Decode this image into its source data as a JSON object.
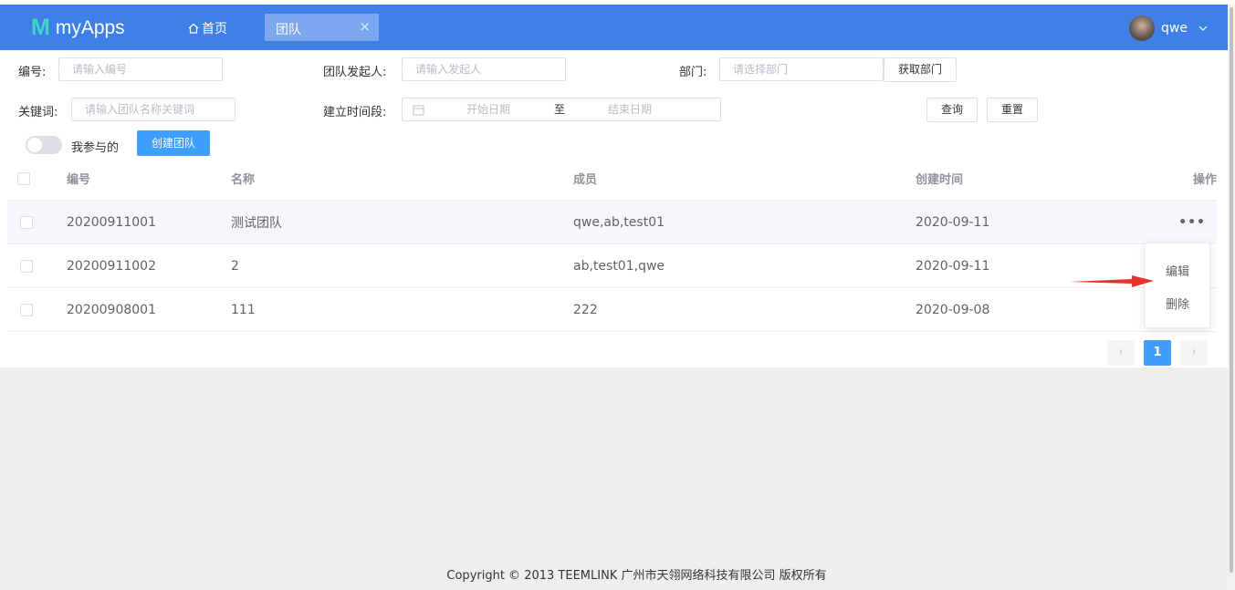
{
  "header": {
    "logo_mark": "M",
    "app_name": "myApps",
    "home_label": "首页",
    "active_tab": "团队",
    "tab_close": "×",
    "user_name": "qwe"
  },
  "filters": {
    "code_label": "编号:",
    "code_placeholder": "请输入编号",
    "initiator_label": "团队发起人:",
    "initiator_placeholder": "请输入发起人",
    "dept_label": "部门:",
    "dept_placeholder": "请选择部门",
    "fetch_dept_btn": "获取部门",
    "keyword_label": "关键词:",
    "keyword_placeholder": "请输入团队名称关键词",
    "period_label": "建立时间段:",
    "start_placeholder": "开始日期",
    "to_label": "至",
    "end_placeholder": "结束日期",
    "query_btn": "查询",
    "reset_btn": "重置",
    "mine_label": "我参与的",
    "create_btn": "创建团队"
  },
  "table": {
    "columns": [
      "编号",
      "名称",
      "成员",
      "创建时间",
      "操作"
    ],
    "rows": [
      {
        "code": "20200911001",
        "name": "测试团队",
        "members": "qwe,ab,test01",
        "created": "2020-09-11"
      },
      {
        "code": "20200911002",
        "name": "2",
        "members": "ab,test01,qwe",
        "created": "2020-09-11"
      },
      {
        "code": "20200908001",
        "name": "111",
        "members": "222",
        "created": "2020-09-08"
      }
    ],
    "more_icon": "•••"
  },
  "menu": {
    "edit": "编辑",
    "delete": "删除"
  },
  "pager": {
    "prev": "‹",
    "current": "1",
    "next": "›"
  },
  "footer": {
    "text": "Copyright © 2013 TEEMLINK 广州市天翎网络科技有限公司 版权所有"
  },
  "colors": {
    "header": "#3e80e6",
    "primary": "#409eff",
    "logo": "#3fd7c2",
    "annotation_arrow": "#e8322e"
  }
}
